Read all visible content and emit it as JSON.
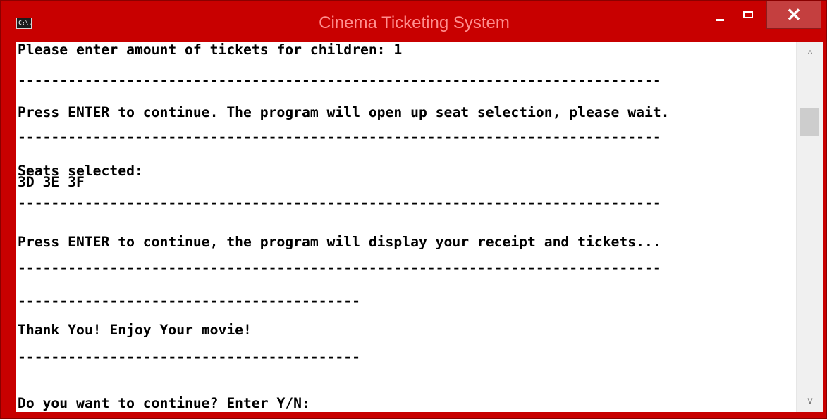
{
  "window": {
    "title": "Cinema Ticketing System",
    "app_icon_text": "C:\\.",
    "close_label": "✕",
    "min_icon": "minimize-icon",
    "max_icon": "maximize-icon",
    "accent_color": "#c80000"
  },
  "console": {
    "lines": [
      {
        "text": "Please enter amount of tickets for children: 1"
      },
      {
        "text": "-----------------------------------------------------------------------------"
      },
      {
        "text": "Press ENTER to continue. The program will open up seat selection, please wait."
      },
      {
        "text": "-----------------------------------------------------------------------------"
      },
      {
        "text": "Seats selected:"
      },
      {
        "text": "3D 3E 3F"
      },
      {
        "text": "-----------------------------------------------------------------------------"
      },
      {
        "text": "Press ENTER to continue, the program will display your receipt and tickets..."
      },
      {
        "text": "-----------------------------------------------------------------------------"
      },
      {
        "text": "-----------------------------------------"
      },
      {
        "text": "Thank You! Enjoy Your movie!"
      },
      {
        "text": "-----------------------------------------"
      },
      {
        "text": "Do you want to continue? Enter Y/N:"
      }
    ]
  },
  "scrollbar": {
    "up_icon": "scroll-up-arrow-icon",
    "down_icon": "scroll-down-arrow-icon",
    "up_glyph": "^",
    "down_glyph": "v"
  }
}
